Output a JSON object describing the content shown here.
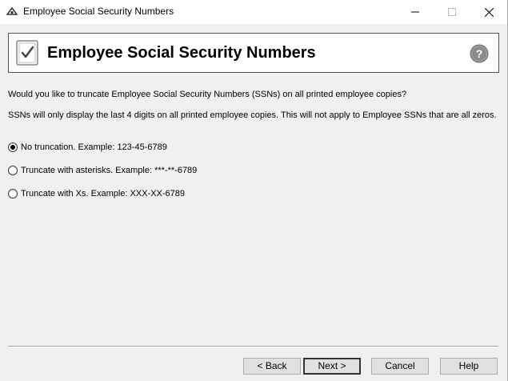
{
  "window": {
    "title": "Employee Social Security Numbers"
  },
  "header": {
    "title": "Employee Social Security Numbers",
    "icon": "checklist-document-icon",
    "help_icon": "question-mark-icon"
  },
  "body": {
    "question": "Would you like to truncate Employee Social Security Numbers (SSNs) on all printed employee copies?",
    "note": "SSNs will only display the last 4 digits on all printed employee copies. This will not apply to Employee SSNs that are all zeros."
  },
  "options": [
    {
      "label": "No truncation. Example: 123-45-6789",
      "selected": true
    },
    {
      "label": "Truncate with asterisks. Example: ***-**-6789",
      "selected": false
    },
    {
      "label": "Truncate with Xs. Example: XXX-XX-6789",
      "selected": false
    }
  ],
  "buttons": {
    "back": "< Back",
    "next": "Next >",
    "cancel": "Cancel",
    "help": "Help"
  }
}
